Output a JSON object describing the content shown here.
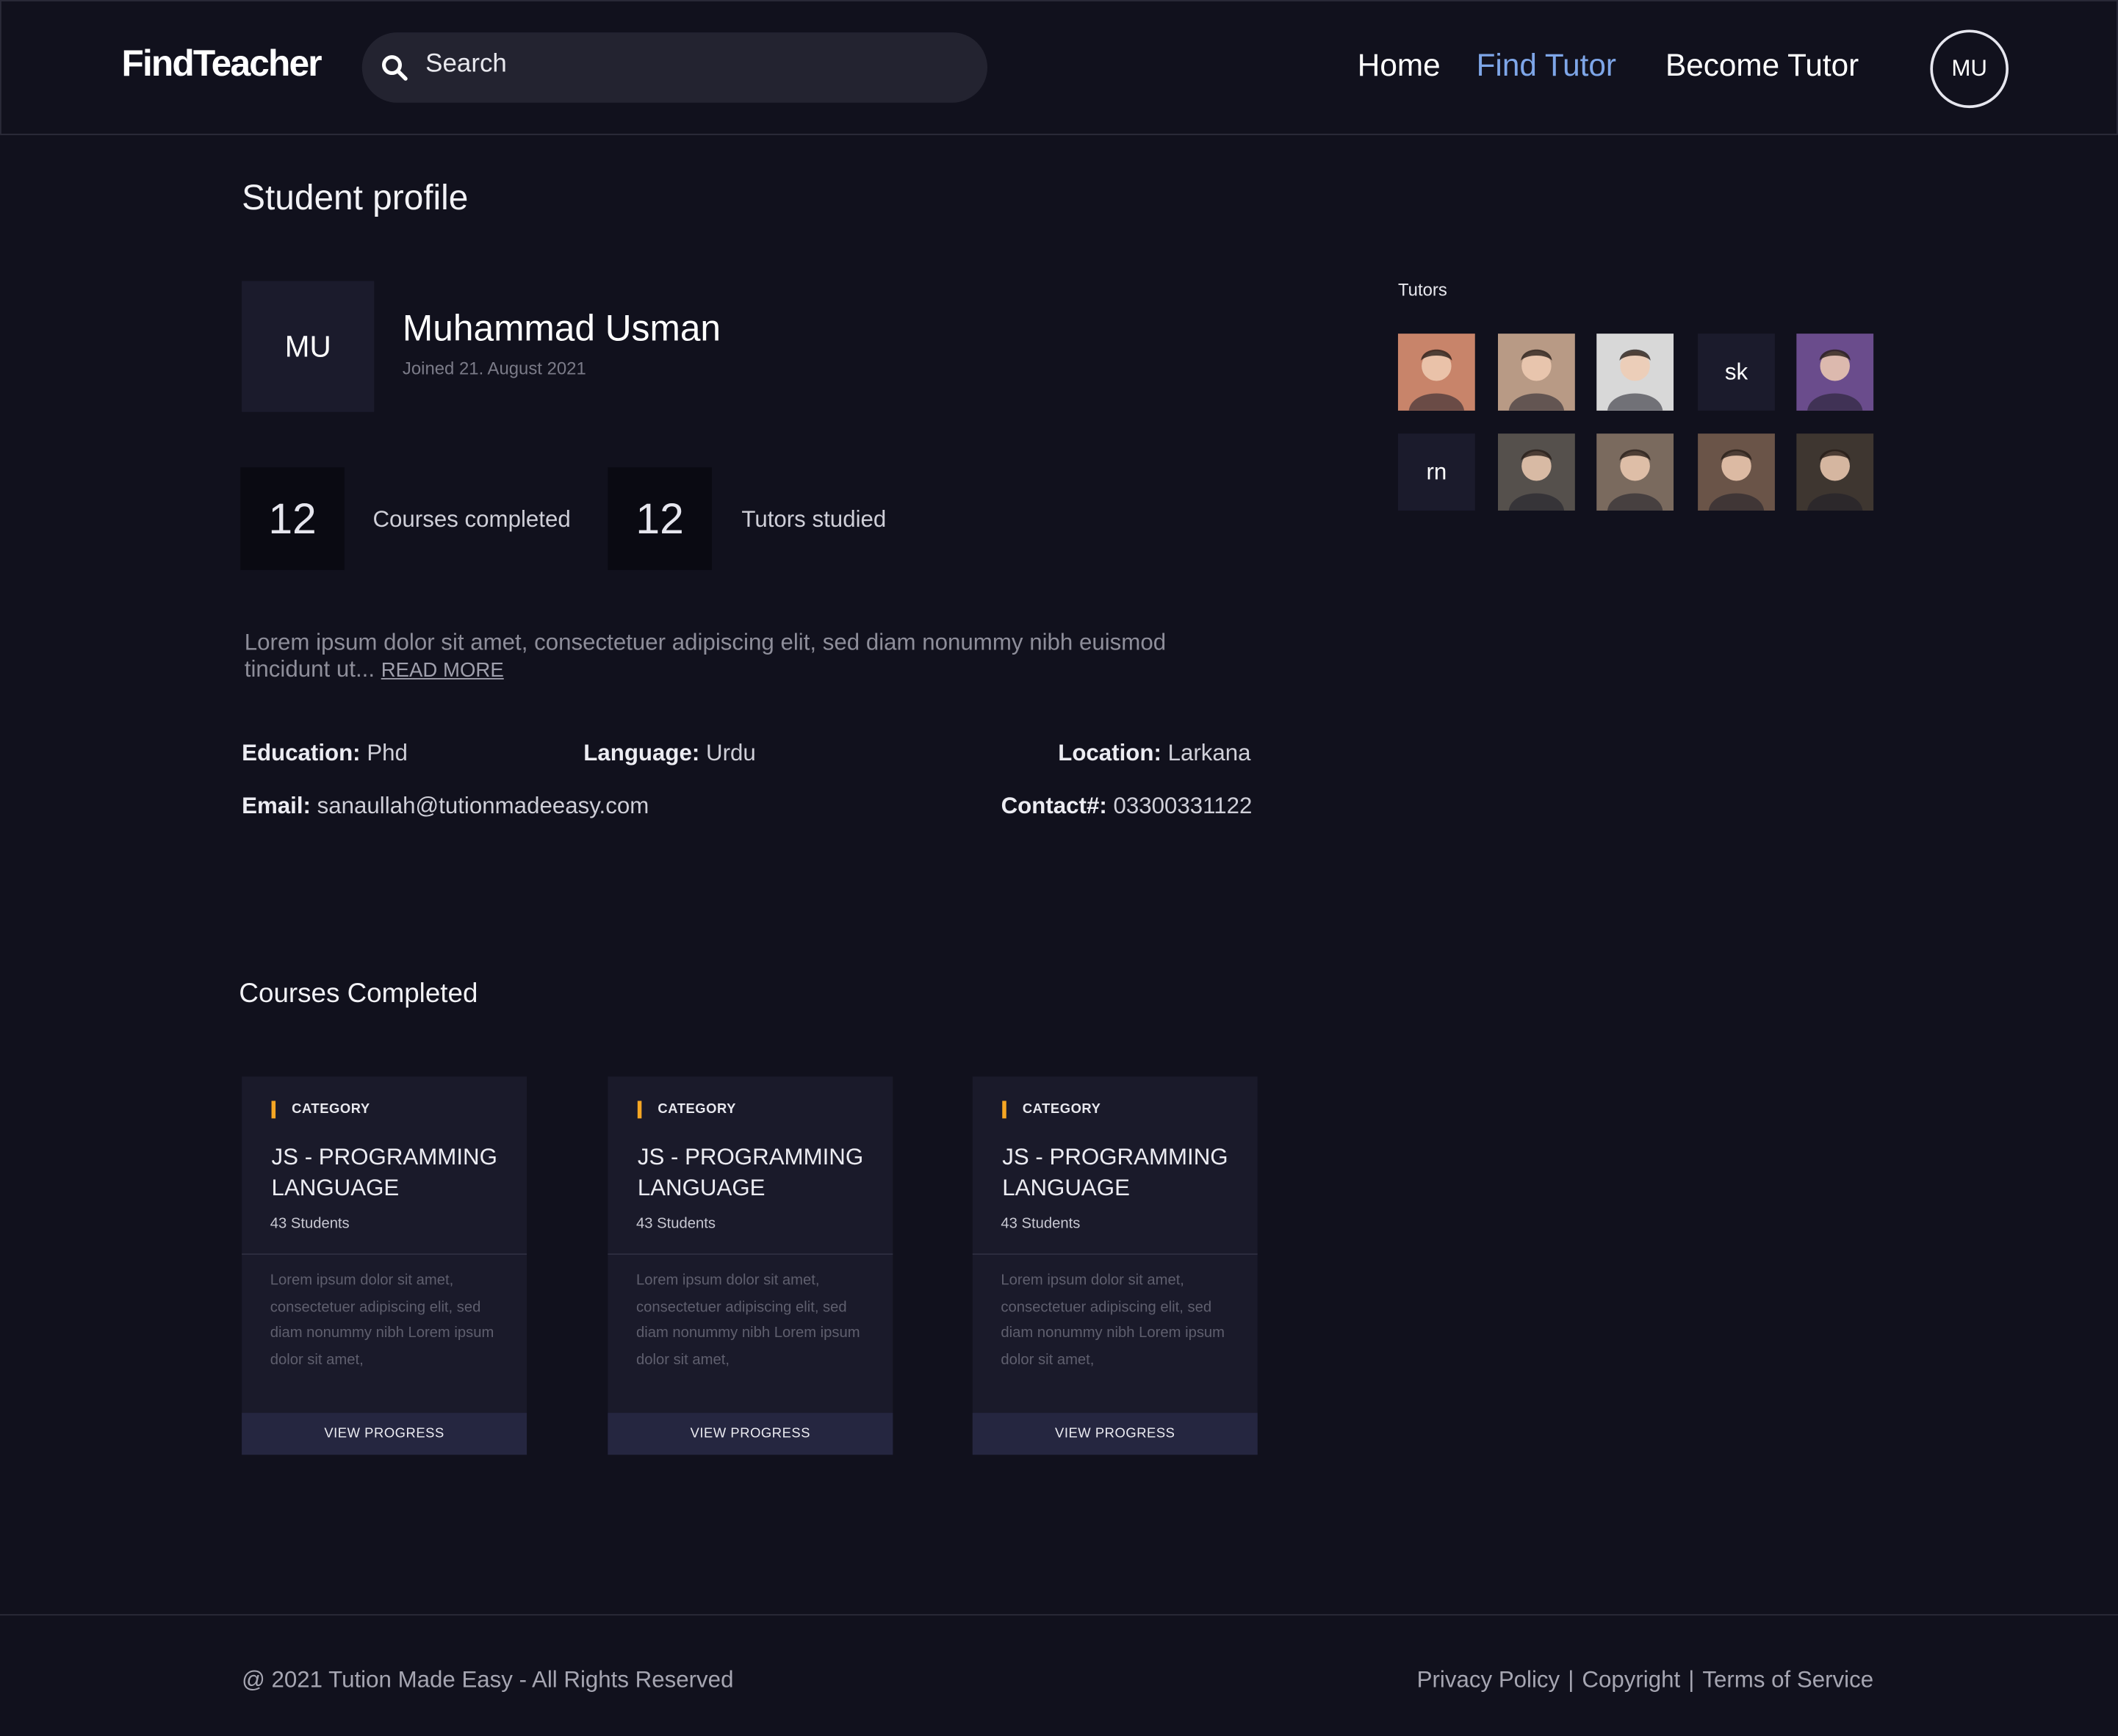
{
  "header": {
    "logo": "FindTeacher",
    "search_placeholder": "Search",
    "nav": [
      "Home",
      "Find Tutor",
      "Become Tutor"
    ],
    "active_nav": "Find Tutor",
    "user_initials": "MU"
  },
  "profile": {
    "page_title": "Student profile",
    "initials": "MU",
    "name": "Muhammad Usman",
    "joined": "Joined 21. August 2021",
    "stats": [
      {
        "value": "12",
        "label": "Courses completed"
      },
      {
        "value": "12",
        "label": "Tutors studied"
      }
    ],
    "bio": "Lorem ipsum dolor sit amet, consectetuer adipiscing elit, sed diam nonummy nibh euismod tincidunt ut...",
    "read_more": "READ MORE",
    "education": {
      "label": "Education:",
      "value": "Phd"
    },
    "language": {
      "label": "Language:",
      "value": "Urdu"
    },
    "location": {
      "label": "Location:",
      "value": "Larkana"
    },
    "email": {
      "label": "Email:",
      "value": "sanaullah@tutionmadeeasy.com"
    },
    "contact": {
      "label": "Contact#:",
      "value": "03300331122"
    }
  },
  "tutors": {
    "label": "Tutors",
    "items": [
      {
        "type": "photo",
        "icon": "tutor-photo-icon",
        "color": "#c8846a"
      },
      {
        "type": "photo",
        "icon": "tutor-photo-icon",
        "color": "#b89a85"
      },
      {
        "type": "photo",
        "icon": "tutor-photo-icon",
        "color": "#d8d8d8"
      },
      {
        "type": "initials",
        "text": "sk"
      },
      {
        "type": "photo",
        "icon": "tutor-photo-icon",
        "color": "#6a4c8c"
      },
      {
        "type": "initials",
        "text": "rn"
      },
      {
        "type": "photo",
        "icon": "tutor-photo-icon",
        "color": "#55504c"
      },
      {
        "type": "photo",
        "icon": "tutor-photo-icon",
        "color": "#7a6a5e"
      },
      {
        "type": "photo",
        "icon": "tutor-photo-icon",
        "color": "#6a5448"
      },
      {
        "type": "photo",
        "icon": "tutor-photo-icon",
        "color": "#3e3630"
      }
    ]
  },
  "courses": {
    "section_title": "Courses Completed",
    "items": [
      {
        "category": "CATEGORY",
        "title": "JS - PROGRAMMING LANGUAGE",
        "students": "43 Students",
        "description": "Lorem ipsum dolor sit amet, consectetuer adipiscing elit, sed diam nonummy nibh Lorem ipsum dolor sit amet,",
        "button": "VIEW PROGRESS"
      },
      {
        "category": "CATEGORY",
        "title": "JS - PROGRAMMING LANGUAGE",
        "students": "43 Students",
        "description": "Lorem ipsum dolor sit amet, consectetuer adipiscing elit, sed diam nonummy nibh Lorem ipsum dolor sit amet,",
        "button": "VIEW PROGRESS"
      },
      {
        "category": "CATEGORY",
        "title": "JS - PROGRAMMING LANGUAGE",
        "students": "43 Students",
        "description": "Lorem ipsum dolor sit amet, consectetuer adipiscing elit, sed diam nonummy nibh Lorem ipsum dolor sit amet,",
        "button": "VIEW PROGRESS"
      }
    ]
  },
  "footer": {
    "copyright": "@ 2021 Tution Made Easy - All Rights Reserved",
    "links": [
      "Privacy Policy",
      "Copyright",
      "Terms of Service"
    ]
  },
  "colors": {
    "background": "#11111d",
    "accent": "#7ea6e8",
    "category_marker": "#f5a623",
    "card": "#1a1a2a"
  }
}
